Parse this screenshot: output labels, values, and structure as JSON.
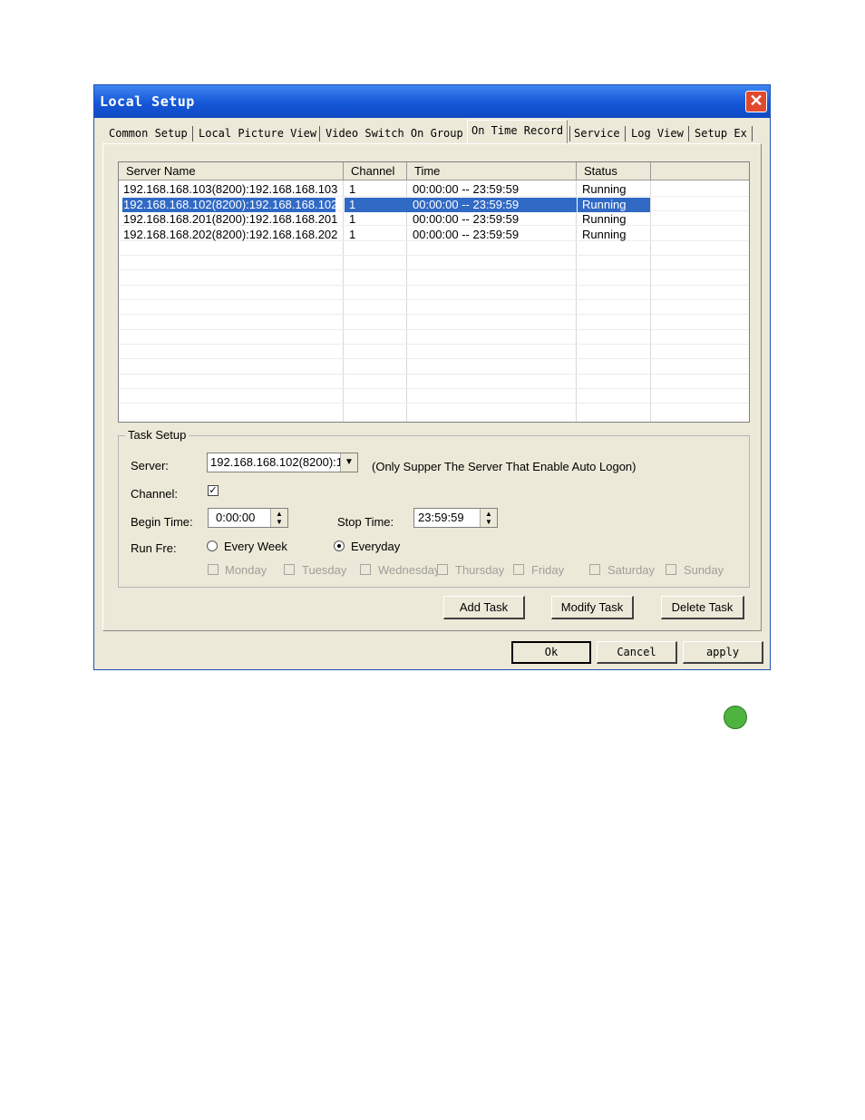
{
  "window": {
    "title": "Local Setup"
  },
  "tabs": [
    "Common Setup",
    "Local Picture View",
    "Video Switch On Group",
    "On Time Record",
    "Service",
    "Log View",
    "Setup Ex"
  ],
  "active_tab": "On Time Record",
  "list": {
    "columns": [
      "Server Name",
      "Channel",
      "Time",
      "Status"
    ],
    "rows": [
      {
        "server": "192.168.168.103(8200):192.168.168.103",
        "channel": "1",
        "time": "00:00:00 -- 23:59:59",
        "status": "Running"
      },
      {
        "server": "192.168.168.102(8200):192.168.168.102",
        "channel": "1",
        "time": "00:00:00 -- 23:59:59",
        "status": "Running",
        "selected": true
      },
      {
        "server": "192.168.168.201(8200):192.168.168.201",
        "channel": "1",
        "time": "00:00:00 -- 23:59:59",
        "status": "Running"
      },
      {
        "server": "192.168.168.202(8200):192.168.168.202",
        "channel": "1",
        "time": "00:00:00 -- 23:59:59",
        "status": "Running"
      }
    ]
  },
  "task_setup": {
    "group_label": "Task Setup",
    "server_label": "Server:",
    "server_value": "192.168.168.102(8200):1",
    "server_note": "(Only Supper The Server That Enable Auto Logon)",
    "channel_label": "Channel:",
    "channel_checked": true,
    "begin_label": "Begin Time:",
    "begin_value": "0:00:00",
    "stop_label": "Stop Time:",
    "stop_value": "23:59:59",
    "runfre_label": "Run Fre:",
    "every_week": "Every Week",
    "everyday": "Everyday",
    "selected_frequency": "Everyday",
    "days": [
      "Monday",
      "Tuesday",
      "Wednesday",
      "Thursday",
      "Friday",
      "Saturday",
      "Sunday"
    ]
  },
  "buttons": {
    "add_task": "Add Task",
    "modify_task": "Modify Task",
    "delete_task": "Delete Task",
    "ok": "Ok",
    "cancel": "Cancel",
    "apply": "apply"
  },
  "colors": {
    "titlebar": "#1557d8",
    "selection": "#316ac5",
    "indicator": "#4fb340"
  }
}
